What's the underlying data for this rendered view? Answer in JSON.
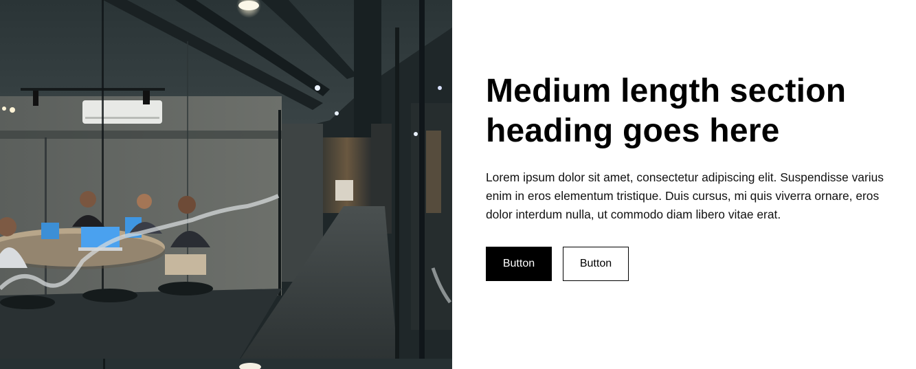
{
  "section": {
    "heading": "Medium length section heading goes here",
    "body": "Lorem ipsum dolor sit amet, consectetur adipiscing elit. Suspendisse varius enim in eros elementum tristique. Duis cursus, mi quis viverra ornare, eros dolor interdum nulla, ut commodo diam libero vitae erat.",
    "primary_button_label": "Button",
    "secondary_button_label": "Button"
  },
  "image": {
    "subject": "office-meeting-room-photo"
  },
  "colors": {
    "primary_button_bg": "#000000",
    "primary_button_text": "#ffffff",
    "secondary_button_bg": "#ffffff",
    "secondary_button_border": "#000000",
    "heading": "#000000"
  }
}
